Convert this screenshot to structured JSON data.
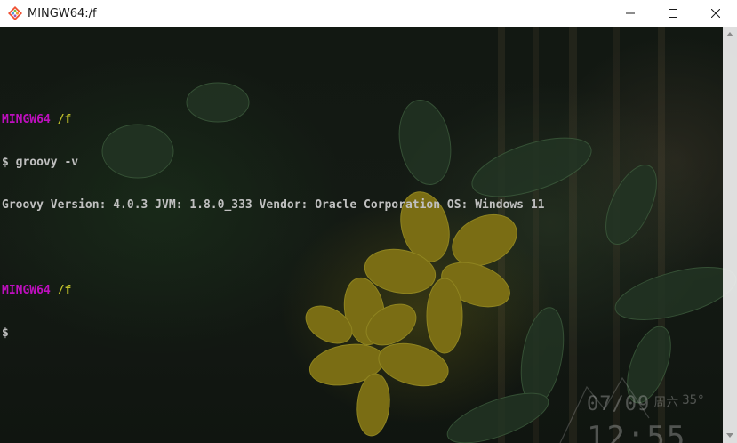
{
  "window": {
    "title": "MINGW64:/f"
  },
  "terminal": {
    "lines": [
      {
        "type": "blank",
        "text": ""
      },
      {
        "type": "prompt",
        "host": "MINGW64",
        "path": "/f"
      },
      {
        "type": "command",
        "text": "$ groovy -v"
      },
      {
        "type": "output",
        "text": "Groovy Version: 4.0.3 JVM: 1.8.0_333 Vendor: Oracle Corporation OS: Windows 11"
      },
      {
        "type": "blank",
        "text": ""
      },
      {
        "type": "prompt",
        "host": "MINGW64",
        "path": "/f"
      },
      {
        "type": "command",
        "text": "$"
      }
    ]
  },
  "wallpaper_clock": {
    "date": "07/09",
    "weekday": "周六",
    "temperature": "35°",
    "time": "12:55"
  },
  "colors": {
    "prompt_host": "#bf0fbf",
    "prompt_path": "#bfbf2a",
    "text": "#c0c0c0"
  }
}
